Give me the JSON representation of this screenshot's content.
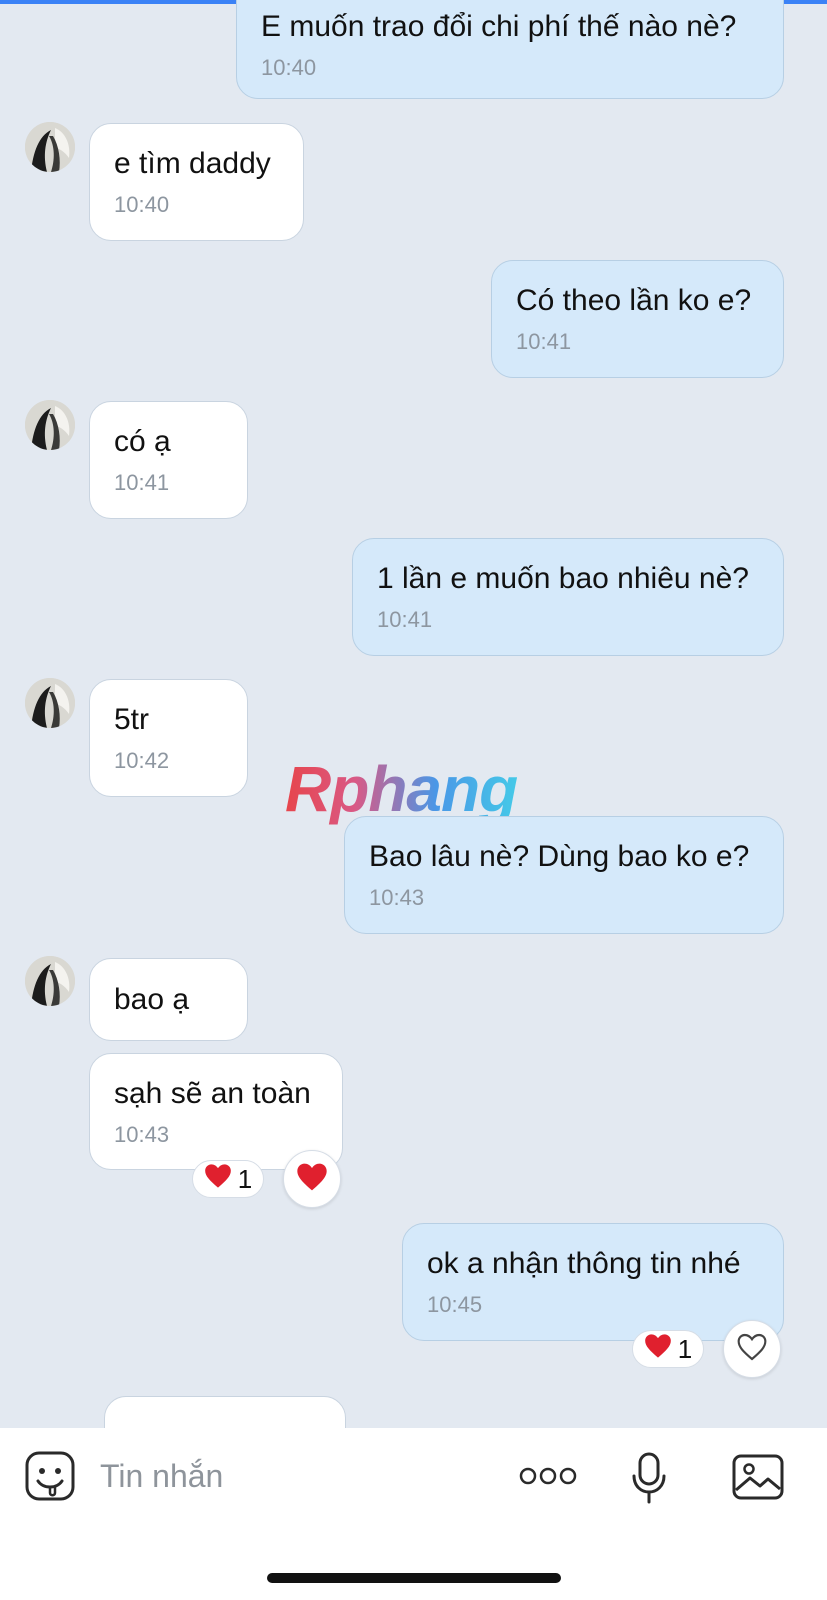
{
  "colors": {
    "background": "#e3e9f1",
    "incoming_bubble": "#ffffff",
    "outgoing_bubble": "#d5e9fa",
    "heart": "#e0202e",
    "timestamp": "#8d96a0"
  },
  "watermark": "Rphang",
  "messages": [
    {
      "direction": "outgoing",
      "text": "E muốn trao đổi chi phí thế nào nè?",
      "time": "10:40"
    },
    {
      "direction": "incoming",
      "text": "e tìm daddy",
      "time": "10:40"
    },
    {
      "direction": "outgoing",
      "text": "Có theo lần ko e?",
      "time": "10:41"
    },
    {
      "direction": "incoming",
      "text": "có ạ",
      "time": "10:41"
    },
    {
      "direction": "outgoing",
      "text": "1 lần e muốn bao nhiêu nè?",
      "time": "10:41"
    },
    {
      "direction": "incoming",
      "text": "5tr",
      "time": "10:42"
    },
    {
      "direction": "outgoing",
      "text": "Bao lâu nè? Dùng bao ko e?",
      "time": "10:43"
    },
    {
      "direction": "incoming",
      "text": "bao ạ"
    },
    {
      "direction": "incoming",
      "text": "sạh sẽ an toàn",
      "time": "10:43",
      "reaction": {
        "icon": "heart-icon",
        "count": "1"
      }
    },
    {
      "direction": "outgoing",
      "text": "ok a nhận thông tin nhé",
      "time": "10:45",
      "reaction": {
        "icon": "heart-icon",
        "count": "1"
      }
    }
  ],
  "composer": {
    "placeholder": "Tin nhắn",
    "icons": [
      "sticker-icon",
      "more-icon",
      "microphone-icon",
      "image-icon"
    ]
  }
}
